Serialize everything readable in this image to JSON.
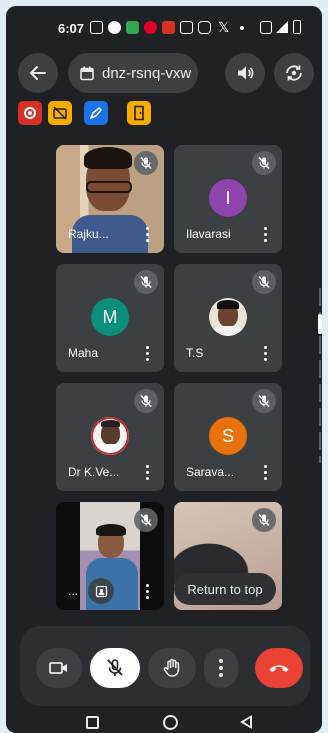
{
  "status_bar": {
    "time": "6:07",
    "right": "▪ ▲ ▮"
  },
  "top_bar": {
    "meeting_code": "dnz-rsnq-vxw",
    "badges": [
      {
        "name": "recording-badge",
        "color": "#d93025"
      },
      {
        "name": "camera-off-badge",
        "color": "#f9ab00"
      },
      {
        "name": "whiteboard-badge",
        "color": "#1a73e8"
      },
      {
        "name": "door-badge",
        "color": "#f9ab00"
      }
    ]
  },
  "participants": [
    {
      "name": "Rajku...",
      "type": "video",
      "muted": true
    },
    {
      "name": "Ilavarasi",
      "type": "initial",
      "initial": "I",
      "color": "#8e44ad",
      "muted": true
    },
    {
      "name": "Maha",
      "type": "initial",
      "initial": "M",
      "color": "#0a8f7a",
      "muted": true
    },
    {
      "name": "T.S",
      "type": "photo",
      "muted": true
    },
    {
      "name": "Dr K.Ve...",
      "type": "photo",
      "muted": true
    },
    {
      "name": "Sarava...",
      "type": "initial",
      "initial": "S",
      "color": "#e8710a",
      "muted": true
    },
    {
      "name": "...",
      "type": "video",
      "muted": true
    },
    {
      "name": "",
      "type": "video",
      "muted": true
    }
  ],
  "return_to_top": "Return to top",
  "controls": {
    "camera": "camera-icon",
    "mic": "mic-off-icon",
    "hand": "raise-hand-icon",
    "more": "more-vert-icon",
    "end_call": "end-call-icon",
    "end_call_color": "#ea4335"
  }
}
